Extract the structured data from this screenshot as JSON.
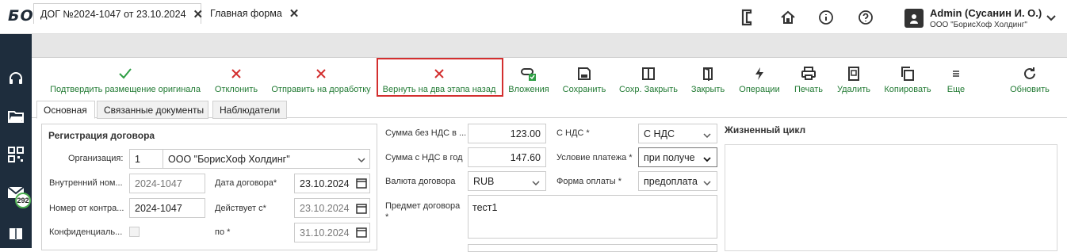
{
  "header": {
    "logo": "БОРИСХОФ",
    "user_name": "Admin (Сусанин И. О.)",
    "user_org": "ООО \"БорисХоф Холдинг\""
  },
  "sidebar": {
    "mail_count": "292"
  },
  "tabs": [
    {
      "label": "ДОГ №2024-1047 от 23.10.2024"
    },
    {
      "label": "Главная форма"
    }
  ],
  "toolbar": {
    "confirm": "Подтвердить размещение оригинала",
    "reject": "Отклонить",
    "send_back": "Отправить на доработку",
    "return_two": "Вернуть на два этапа назад",
    "attachments": "Вложения",
    "save": "Сохранить",
    "save_close": "Сохр. Закрыть",
    "close": "Закрыть",
    "operations": "Операции",
    "print": "Печать",
    "delete": "Удалить",
    "copy": "Копировать",
    "more": "Еще",
    "refresh": "Обновить"
  },
  "content_tabs": [
    "Основная",
    "Связанные документы",
    "Наблюдатели"
  ],
  "registration": {
    "title": "Регистрация договора",
    "org_label": "Организация:",
    "org_code": "1",
    "org_value": "ООО \"БорисХоф Холдинг\"",
    "internal_label": "Внутренний ном...",
    "internal_value": "2024-1047",
    "counter_label": "Номер от контра...",
    "counter_value": "2024-1047",
    "conf_label": "Конфиденциаль...",
    "date_label": "Дата договора*",
    "date_value": "23.10.2024",
    "valid_label": "Действует с*",
    "valid_value": "23.10.2024",
    "to_label": "по *",
    "to_value": "31.10.2024"
  },
  "amounts": {
    "no_vat_label": "Сумма без НДС в ...",
    "no_vat_value": "123.00",
    "with_vat_label": "Сумма с НДС в год",
    "with_vat_value": "147.60",
    "currency_label": "Валюта договора",
    "currency_value": "RUB",
    "subject_label": "Предмет договора",
    "subject_req": "*",
    "subject_value": "тест1",
    "vat_label": "С НДС *",
    "vat_value": "С НДС",
    "payment_cond_label": "Условие платежа *",
    "payment_cond_value": "при получе",
    "payment_form_label": "Форма оплаты *",
    "payment_form_value": "предоплата"
  },
  "lifecycle": {
    "title": "Жизненный цикл"
  },
  "colors": {
    "accent_green": "#217a33",
    "reject_red": "#d32f2f",
    "sidebar": "#1e2d3d"
  }
}
